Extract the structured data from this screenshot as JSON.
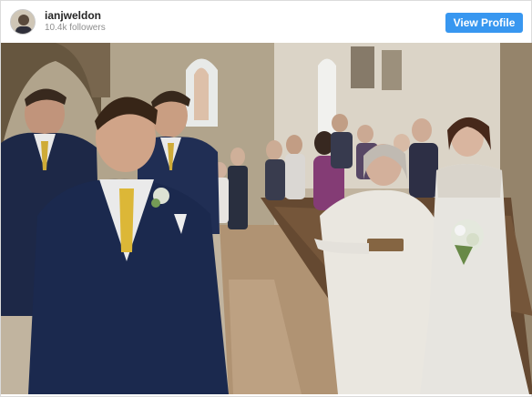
{
  "profile": {
    "username": "ianjweldon",
    "followers": "10.4k followers",
    "view_profile_label": "View Profile"
  },
  "colors": {
    "button_bg": "#3897f0",
    "username_text": "#262626",
    "meta_text": "#8e8e8e"
  },
  "icons": {
    "avatar": "profile-avatar-photo"
  },
  "photo": {
    "subject": "church-wedding-aisle"
  }
}
